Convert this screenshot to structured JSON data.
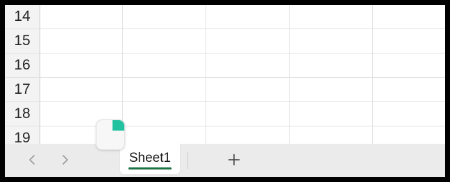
{
  "spreadsheet": {
    "row_headers": [
      "14",
      "15",
      "16",
      "17",
      "18",
      "19"
    ]
  },
  "tabbar": {
    "prev_icon": "chevron-left-icon",
    "next_icon": "chevron-right-icon",
    "sheet_tab_label": "Sheet1",
    "add_sheet_icon": "plus-icon",
    "accent_color": "#1e7145"
  },
  "widget": {
    "icon": "pie-chart-icon",
    "accent_color": "#22c1a0"
  }
}
